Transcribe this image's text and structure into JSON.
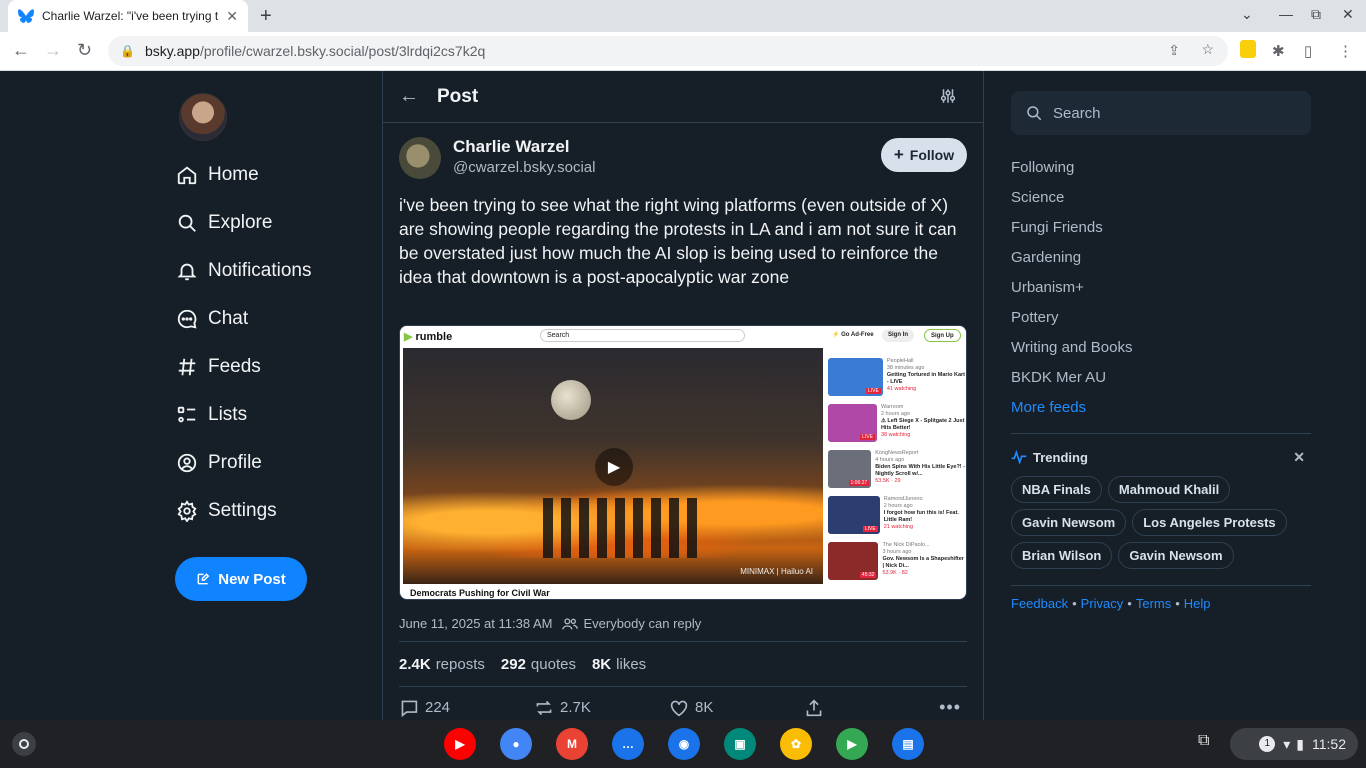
{
  "browser": {
    "tab_title": "Charlie Warzel: \"i've been trying t",
    "url_host": "bsky.app",
    "url_path": "/profile/cwarzel.bsky.social/post/3lrdqi2cs7k2q"
  },
  "sidebar": {
    "items": [
      {
        "label": "Home",
        "icon": "home-icon"
      },
      {
        "label": "Explore",
        "icon": "search-icon"
      },
      {
        "label": "Notifications",
        "icon": "bell-icon"
      },
      {
        "label": "Chat",
        "icon": "chat-icon"
      },
      {
        "label": "Feeds",
        "icon": "hash-icon"
      },
      {
        "label": "Lists",
        "icon": "list-icon"
      },
      {
        "label": "Profile",
        "icon": "user-icon"
      },
      {
        "label": "Settings",
        "icon": "gear-icon"
      }
    ],
    "new_post_label": "New Post"
  },
  "header": {
    "title": "Post"
  },
  "post": {
    "author_name": "Charlie Warzel",
    "author_handle": "@cwarzel.bsky.social",
    "follow_label": "Follow",
    "text": "i've been trying to see what the right wing platforms (even outside of X) are showing people regarding the protests in LA and i am not sure it can be overstated just how much the AI slop is being used to reinforce the idea that downtown is a post-apocalyptic war zone",
    "timestamp": "June 11, 2025 at 11:38 AM",
    "reply_setting": "Everybody can reply",
    "reposts_count": "2.4K",
    "reposts_label": "reposts",
    "quotes_count": "292",
    "quotes_label": "quotes",
    "likes_count": "8K",
    "likes_label": "likes",
    "actions": {
      "replies": "224",
      "reposts": "2.7K",
      "likes": "8K"
    }
  },
  "embed": {
    "logo": "rumble",
    "search_placeholder": "Search",
    "go_ad_free": "Go Ad-Free",
    "sign_in": "Sign In",
    "sign_up": "Sign Up",
    "video_title": "Democrats Pushing for Civil War",
    "watermark": "MINIMAX  |  Hailuo AI",
    "sidebar_videos": [
      {
        "channel": "PeopleHall",
        "time": "38 minutes ago",
        "title": "Getting Tortured in Mario Kart - LIVE",
        "status": "41 watching",
        "live": "LIVE",
        "color": "#3a7bd5"
      },
      {
        "channel": "Warroom",
        "time": "2 hours ago",
        "title": "⚠ Left Siege X - Splitgate 2 Just Hits Better!",
        "status": "38 watching",
        "live": "LIVE",
        "color": "#b048a8"
      },
      {
        "channel": "KongNewsReport",
        "time": "4 hours ago",
        "title": "Biden Spins With His Little Eye?! - Nightly Scroll w/...",
        "status": "53.5K  ·  29",
        "live": "1:06:27",
        "color": "#6a6f7a"
      },
      {
        "channel": "RamondJuneno",
        "time": "2 hours ago",
        "title": "I forgot how fun this is! Feat. Little Ram!",
        "status": "21 watching",
        "live": "LIVE",
        "color": "#2c3e70"
      },
      {
        "channel": "The Nick DiPaolo...",
        "time": "3 hours ago",
        "title": "Gov. Newsom Is a Shapeshifter | Nick Di...",
        "status": "53.9K  ·  82",
        "live": "45:32",
        "color": "#8c2a2a"
      }
    ]
  },
  "right": {
    "search_placeholder": "Search",
    "feeds": [
      "Following",
      "Science",
      "Fungi Friends",
      "Gardening",
      "Urbanism+",
      "Pottery",
      "Writing and Books",
      "BKDK Mer AU"
    ],
    "more_feeds": "More feeds",
    "trending_label": "Trending",
    "trending": [
      "NBA Finals",
      "Mahmoud Khalil",
      "Gavin Newsom",
      "Los Angeles Protests",
      "Brian Wilson",
      "Gavin Newsom"
    ],
    "footer": [
      "Feedback",
      "Privacy",
      "Terms",
      "Help"
    ]
  },
  "shelf": {
    "apps": [
      {
        "name": "youtube-app-icon",
        "color": "#ff0000",
        "glyph": "▶"
      },
      {
        "name": "chrome-app-icon",
        "color": "#4285f4",
        "glyph": "●"
      },
      {
        "name": "gmail-app-icon",
        "color": "#ea4335",
        "glyph": "M"
      },
      {
        "name": "messages-app-icon",
        "color": "#1a73e8",
        "glyph": "…"
      },
      {
        "name": "camera-app-icon",
        "color": "#1a73e8",
        "glyph": "◉"
      },
      {
        "name": "meet-app-icon",
        "color": "#00897b",
        "glyph": "▣"
      },
      {
        "name": "photos-app-icon",
        "color": "#fbbc04",
        "glyph": "✿"
      },
      {
        "name": "play-store-app-icon",
        "color": "#34a853",
        "glyph": "▶"
      },
      {
        "name": "files-app-icon",
        "color": "#1a73e8",
        "glyph": "▤"
      }
    ],
    "notification_count": "1",
    "time": "11:52"
  }
}
